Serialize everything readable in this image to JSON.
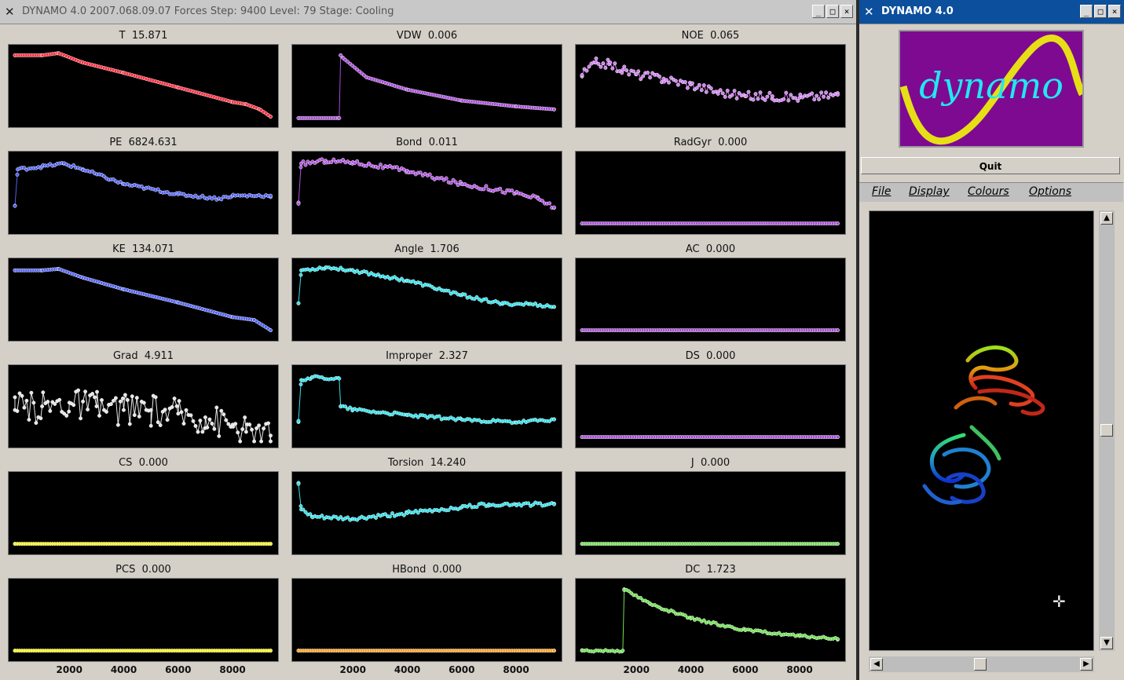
{
  "main_window": {
    "title": "DYNAMO 4.0 2007.068.09.07 Forces Step: 9400 Level: 79 Stage: Cooling",
    "icon": "x-window-icon",
    "buttons": {
      "minimize": "_",
      "maximize": "□",
      "close": "×"
    }
  },
  "side_window": {
    "title": "DYNAMO 4.0",
    "icon": "x-window-icon",
    "buttons": {
      "minimize": "_",
      "maximize": "□",
      "close": "×"
    },
    "logo_text": "dynamo",
    "logo_colors": {
      "background": "#7e0a92",
      "curve": "#e6df16",
      "text": "#22e7ef"
    },
    "quit_label": "Quit",
    "menu": [
      "File",
      "Display",
      "Colours",
      "Options"
    ],
    "viewer_cursor": "crosshair-icon"
  },
  "x_axis": {
    "ticks": [
      "2000",
      "4000",
      "6000",
      "8000"
    ],
    "xlim": [
      0,
      9500
    ]
  },
  "chart_data": [
    {
      "label": "T",
      "value": "15.871",
      "color": "#ff2a3c",
      "x": [
        0,
        1000,
        1600,
        2500,
        4000,
        6000,
        8000,
        8500,
        9000,
        9400
      ],
      "y": [
        0.92,
        0.92,
        0.95,
        0.82,
        0.68,
        0.48,
        0.28,
        0.25,
        0.18,
        0.08
      ]
    },
    {
      "label": "VDW",
      "value": "0.006",
      "color": "#a64ad6",
      "x": [
        0,
        1500,
        1550,
        1650,
        2500,
        4000,
        6000,
        8000,
        9400
      ],
      "y": [
        0.06,
        0.06,
        0.92,
        0.88,
        0.62,
        0.45,
        0.3,
        0.22,
        0.18
      ],
      "step_at": 1500
    },
    {
      "label": "NOE",
      "value": "0.065",
      "color": "#d080f0",
      "x": [
        0,
        500,
        1000,
        1500,
        2000,
        3000,
        4000,
        5000,
        6000,
        7000,
        8000,
        9400
      ],
      "y": [
        0.65,
        0.82,
        0.8,
        0.72,
        0.66,
        0.6,
        0.52,
        0.42,
        0.36,
        0.36,
        0.34,
        0.38
      ],
      "noise": 0.06
    },
    {
      "label": "PE",
      "value": "6824.631",
      "color": "#5060f0",
      "x": [
        0,
        100,
        1000,
        1800,
        2500,
        4000,
        6000,
        7500,
        8000,
        9400
      ],
      "y": [
        0.32,
        0.82,
        0.86,
        0.9,
        0.82,
        0.62,
        0.48,
        0.42,
        0.46,
        0.46
      ],
      "noise": 0.02
    },
    {
      "label": "Bond",
      "value": "0.011",
      "color": "#b050e0",
      "x": [
        0,
        100,
        1000,
        2000,
        4000,
        6000,
        8000,
        8800,
        9400
      ],
      "y": [
        0.35,
        0.9,
        0.94,
        0.92,
        0.8,
        0.62,
        0.5,
        0.42,
        0.3
      ],
      "noise": 0.03
    },
    {
      "label": "RadGyr",
      "value": "0.000",
      "color": "#a64ad6",
      "x": [
        0,
        9400
      ],
      "y": [
        0.08,
        0.08
      ]
    },
    {
      "label": "KE",
      "value": "134.071",
      "color": "#5060f0",
      "x": [
        0,
        1000,
        1600,
        2500,
        4000,
        6000,
        8000,
        8800,
        9400
      ],
      "y": [
        0.9,
        0.9,
        0.92,
        0.8,
        0.64,
        0.46,
        0.26,
        0.22,
        0.08
      ]
    },
    {
      "label": "Angle",
      "value": "1.706",
      "color": "#30e0e8",
      "x": [
        0,
        100,
        1000,
        2000,
        4000,
        6000,
        7500,
        8500,
        9400
      ],
      "y": [
        0.45,
        0.9,
        0.94,
        0.9,
        0.76,
        0.56,
        0.44,
        0.44,
        0.4
      ],
      "noise": 0.02
    },
    {
      "label": "AC",
      "value": "0.000",
      "color": "#a64ad6",
      "x": [
        0,
        9400
      ],
      "y": [
        0.08,
        0.08
      ]
    },
    {
      "label": "Grad",
      "value": "4.911",
      "color": "#e6e6e6",
      "x": [
        0,
        1000,
        2000,
        3000,
        4000,
        5000,
        6000,
        7000,
        8000,
        8500,
        9400
      ],
      "y": [
        0.45,
        0.5,
        0.55,
        0.5,
        0.45,
        0.45,
        0.4,
        0.35,
        0.25,
        0.15,
        0.1
      ],
      "noise": 0.22
    },
    {
      "label": "Improper",
      "value": "2.327",
      "color": "#30e0e8",
      "x": [
        0,
        100,
        500,
        1500,
        1550,
        2000,
        4000,
        6000,
        8000,
        9400
      ],
      "y": [
        0.3,
        0.86,
        0.9,
        0.88,
        0.5,
        0.46,
        0.38,
        0.32,
        0.28,
        0.32
      ],
      "noise": 0.02
    },
    {
      "label": "DS",
      "value": "0.000",
      "color": "#a64ad6",
      "x": [
        0,
        9400
      ],
      "y": [
        0.08,
        0.08
      ]
    },
    {
      "label": "CS",
      "value": "0.000",
      "color": "#f2f21a",
      "x": [
        0,
        9400
      ],
      "y": [
        0.08,
        0.08
      ]
    },
    {
      "label": "Torsion",
      "value": "14.240",
      "color": "#30e0e8",
      "x": [
        0,
        100,
        500,
        2000,
        4000,
        6000,
        7000,
        8000,
        9400
      ],
      "y": [
        0.9,
        0.55,
        0.45,
        0.42,
        0.5,
        0.58,
        0.62,
        0.62,
        0.62
      ],
      "noise": 0.025
    },
    {
      "label": "J",
      "value": "0.000",
      "color": "#6ee050",
      "x": [
        0,
        9400
      ],
      "y": [
        0.08,
        0.08
      ]
    },
    {
      "label": "PCS",
      "value": "0.000",
      "color": "#f2f21a",
      "x": [
        0,
        9400
      ],
      "y": [
        0.08,
        0.08
      ]
    },
    {
      "label": "HBond",
      "value": "0.000",
      "color": "#ffa020",
      "x": [
        0,
        9400
      ],
      "y": [
        0.08,
        0.08
      ]
    },
    {
      "label": "DC",
      "value": "1.723",
      "color": "#6ee050",
      "x": [
        0,
        1500,
        1550,
        2500,
        4000,
        6000,
        8000,
        9400
      ],
      "y": [
        0.08,
        0.08,
        0.92,
        0.72,
        0.52,
        0.36,
        0.28,
        0.24
      ],
      "noise": 0.015
    }
  ]
}
